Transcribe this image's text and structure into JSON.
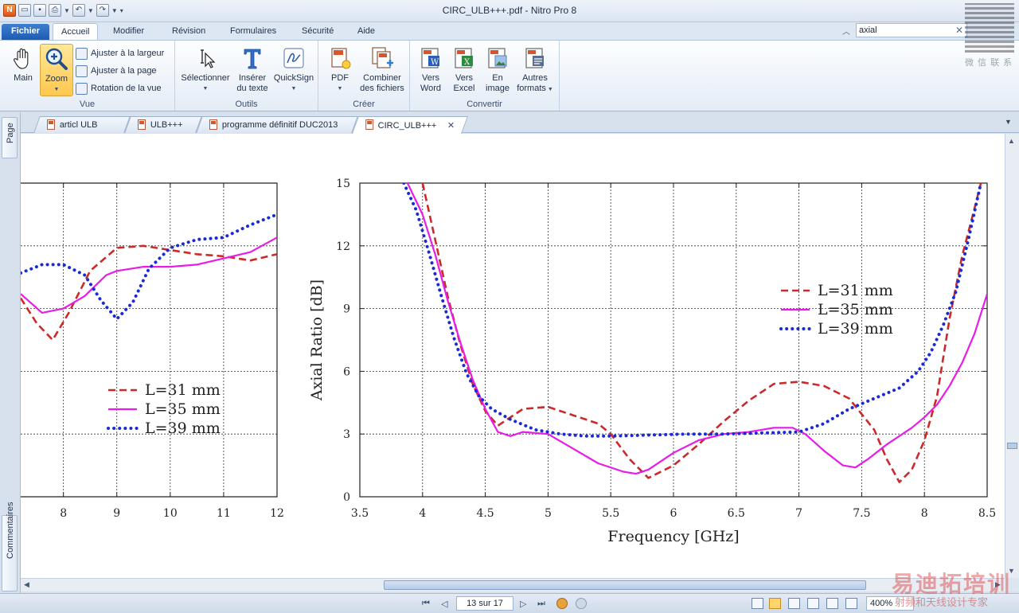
{
  "window": {
    "title": "CIRC_ULB+++.pdf - Nitro Pro 8"
  },
  "menu": {
    "tabs": [
      "Fichier",
      "Accueil",
      "Modifier",
      "Révision",
      "Formulaires",
      "Sécurité",
      "Aide"
    ],
    "active": "Accueil",
    "search_value": "axial"
  },
  "ribbon": {
    "vue": {
      "label": "Vue",
      "main": "Main",
      "zoom": "Zoom",
      "fit_width": "Ajuster à la largeur",
      "fit_page": "Ajuster à la page",
      "rotate": "Rotation de la vue"
    },
    "outils": {
      "label": "Outils",
      "select": "Sélectionner",
      "insert_text_1": "Insérer",
      "insert_text_2": "du texte",
      "quicksign": "QuickSign"
    },
    "creer": {
      "label": "Créer",
      "pdf": "PDF",
      "combine_1": "Combiner",
      "combine_2": "des fichiers"
    },
    "convertir": {
      "label": "Convertir",
      "word_1": "Vers",
      "word_2": "Word",
      "excel_1": "Vers",
      "excel_2": "Excel",
      "image_1": "En",
      "image_2": "image",
      "other_1": "Autres",
      "other_2": "formats"
    }
  },
  "side_tabs": {
    "page": "Page",
    "comments": "Commentaires"
  },
  "doc_tabs": [
    "articl ULB",
    "ULB+++",
    "programme définitif DUC2013",
    "CIRC_ULB+++"
  ],
  "status": {
    "page": "13 sur 17",
    "zoom": "400%"
  },
  "watermark": {
    "qr_caption": "微 信 联 系",
    "brand": "易迪拓培训",
    "sub": "射频和天线设计专家"
  },
  "colors": {
    "red": "#cc2a2a",
    "magenta": "#e81ce8",
    "blue": "#1a2ad6",
    "accent": "#1d5bb3"
  },
  "chart_data": [
    {
      "type": "line",
      "title": "",
      "xlabel": "",
      "ylabel": "",
      "xlim": [
        7.2,
        12
      ],
      "ylim": [
        0,
        15
      ],
      "x_ticks": [
        "8",
        "9",
        "10",
        "11",
        "12"
      ],
      "grid": true,
      "legend_position": "lower-center",
      "series": [
        {
          "name": "L=31 mm",
          "style": "dashed",
          "x": [
            7.2,
            7.5,
            7.8,
            8.1,
            8.5,
            9.0,
            9.5,
            10.0,
            10.5,
            11.0,
            11.5,
            12.0
          ],
          "y": [
            9.5,
            8.3,
            7.5,
            8.8,
            10.8,
            11.9,
            12.0,
            11.8,
            11.6,
            11.5,
            11.3,
            11.6
          ]
        },
        {
          "name": "L=35 mm",
          "style": "solid",
          "x": [
            7.2,
            7.6,
            8.0,
            8.4,
            8.8,
            9.0,
            9.5,
            10.0,
            10.5,
            11.0,
            11.5,
            12.0
          ],
          "y": [
            9.7,
            8.8,
            9.0,
            9.6,
            10.6,
            10.8,
            11.0,
            11.0,
            11.1,
            11.4,
            11.7,
            12.4
          ]
        },
        {
          "name": "L=39 mm",
          "style": "dotted",
          "x": [
            7.2,
            7.6,
            8.0,
            8.4,
            8.7,
            9.0,
            9.3,
            9.6,
            10.0,
            10.5,
            11.0,
            11.5,
            12.0
          ],
          "y": [
            10.7,
            11.1,
            11.1,
            10.6,
            9.4,
            8.5,
            9.3,
            10.9,
            11.9,
            12.3,
            12.4,
            13.0,
            13.5
          ]
        }
      ]
    },
    {
      "type": "line",
      "title": "",
      "xlabel": "Frequency [GHz]",
      "ylabel": "Axial Ratio [dB]",
      "xlim": [
        3.5,
        8.5
      ],
      "ylim": [
        0,
        15
      ],
      "x_ticks": [
        "3.5",
        "4",
        "4.5",
        "5",
        "5.5",
        "6",
        "6.5",
        "7",
        "7.5",
        "8",
        "8.5"
      ],
      "y_ticks": [
        "0",
        "3",
        "6",
        "9",
        "12",
        "15"
      ],
      "grid": true,
      "legend_position": "upper-right",
      "series": [
        {
          "name": "L=31 mm",
          "style": "dashed",
          "x": [
            4.0,
            4.1,
            4.2,
            4.3,
            4.4,
            4.5,
            4.6,
            4.7,
            4.8,
            5.0,
            5.2,
            5.4,
            5.5,
            5.65,
            5.8,
            6.0,
            6.2,
            6.4,
            6.6,
            6.8,
            7.0,
            7.2,
            7.4,
            7.6,
            7.7,
            7.8,
            7.9,
            8.0,
            8.1,
            8.2,
            8.3,
            8.4,
            8.45
          ],
          "y": [
            15.0,
            12.3,
            9.6,
            7.3,
            5.4,
            4.1,
            3.4,
            3.8,
            4.2,
            4.3,
            3.9,
            3.5,
            3.0,
            1.8,
            0.9,
            1.5,
            2.5,
            3.6,
            4.6,
            5.4,
            5.5,
            5.3,
            4.7,
            3.2,
            1.8,
            0.7,
            1.3,
            2.7,
            4.8,
            8.5,
            11.5,
            13.8,
            15.0
          ]
        },
        {
          "name": "L=35 mm",
          "style": "solid",
          "x": [
            3.88,
            4.0,
            4.1,
            4.2,
            4.3,
            4.4,
            4.5,
            4.6,
            4.7,
            4.8,
            5.0,
            5.2,
            5.4,
            5.6,
            5.7,
            5.8,
            6.0,
            6.2,
            6.4,
            6.6,
            6.8,
            6.95,
            7.05,
            7.2,
            7.35,
            7.45,
            7.55,
            7.7,
            7.9,
            8.0,
            8.1,
            8.2,
            8.3,
            8.4,
            8.5
          ],
          "y": [
            15.0,
            13.5,
            11.6,
            9.4,
            7.4,
            5.6,
            4.2,
            3.1,
            2.9,
            3.1,
            3.0,
            2.3,
            1.6,
            1.2,
            1.1,
            1.3,
            2.1,
            2.7,
            3.0,
            3.1,
            3.3,
            3.3,
            3.0,
            2.2,
            1.5,
            1.4,
            1.8,
            2.5,
            3.3,
            3.8,
            4.4,
            5.3,
            6.4,
            7.8,
            9.7
          ]
        },
        {
          "name": "L=39 mm",
          "style": "dotted",
          "x": [
            3.85,
            3.95,
            4.05,
            4.15,
            4.25,
            4.35,
            4.45,
            4.55,
            4.7,
            4.9,
            5.1,
            5.3,
            5.5,
            5.8,
            6.1,
            6.4,
            6.7,
            7.0,
            7.2,
            7.4,
            7.6,
            7.8,
            7.95,
            8.05,
            8.15,
            8.25,
            8.35,
            8.45
          ],
          "y": [
            15.0,
            13.7,
            11.7,
            9.6,
            7.6,
            5.9,
            4.8,
            4.2,
            3.7,
            3.2,
            3.0,
            2.9,
            2.9,
            2.95,
            3.0,
            3.0,
            3.05,
            3.1,
            3.5,
            4.2,
            4.7,
            5.2,
            6.0,
            6.9,
            8.2,
            9.8,
            12.3,
            15.0
          ]
        }
      ]
    }
  ]
}
